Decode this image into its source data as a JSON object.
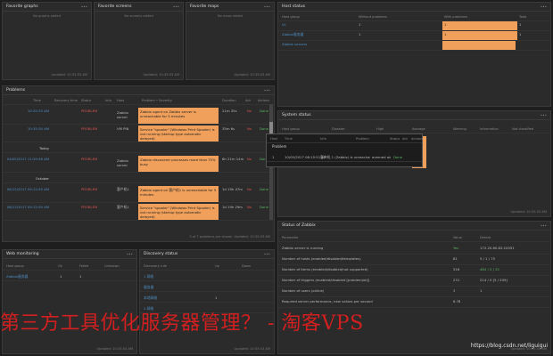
{
  "fav_graphs": {
    "title": "Favorite graphs",
    "empty": "No graphs added",
    "updated": "Updated: 10:35:03 AM"
  },
  "fav_screens": {
    "title": "Favorite screens",
    "empty": "No screens added",
    "updated": "Updated: 10:35:03 AM"
  },
  "fav_maps": {
    "title": "Favorite maps",
    "empty": "No maps added",
    "updated": "Updated: 10:35:03 AM"
  },
  "host_status": {
    "title": "Host status",
    "headers": [
      "Host group",
      "Without problems",
      "With problems",
      "Total"
    ],
    "rows": [
      {
        "group": "Vc",
        "without": "1",
        "with": "1",
        "total": "1"
      },
      {
        "group": "Zabbix服务器",
        "without": "1",
        "with": "1",
        "total": "1"
      },
      {
        "group": "Zabbix servers",
        "without": "",
        "with": "",
        "total": ""
      }
    ]
  },
  "problems": {
    "title": "Problems",
    "headers": [
      "Time",
      "Recovery time",
      "Status",
      "Info",
      "Host",
      "Problem • Severity",
      "Duration",
      "Ack",
      "Actions"
    ],
    "rows": [
      {
        "time": "10:35:33 AM",
        "status": "PROBLEM",
        "host": "Zabbix server",
        "problem": "Zabbix agent on Zabbix server is unreachable for 5 minutes",
        "duration": "21m 35s",
        "ack": "No",
        "action": "Done"
      },
      {
        "time": "10:35:30 AM",
        "status": "PROBLEM",
        "host": "VM PIN",
        "problem": "Service \"spooler\" (Windows Print Spooler) is not running (startup type automatic delayed)",
        "duration": "35m 6s",
        "ack": "No",
        "action": "Done"
      },
      {
        "time": "Today",
        "divider": true
      },
      {
        "time": "04/05/2017 11:59:46 AM",
        "status": "PROBLEM",
        "host": "Zabbix server",
        "problem": "Zabbix discoverer processes more than 75% busy",
        "duration": "6h 21m 14m",
        "ack": "No",
        "action": "Done"
      },
      {
        "time": "October",
        "divider": true
      },
      {
        "time": "06/12/2017 09:12:55 AM",
        "status": "PROBLEM",
        "host": "客户机1",
        "problem": "Zabbix agent on 客户机1 is unreachable for 5 minutes",
        "duration": "1d 19h 47m",
        "ack": "No",
        "action": "Done"
      },
      {
        "time": "06/12/2017 09:12:55 AM",
        "status": "PROBLEM",
        "host": "客户机1",
        "problem": "Service \"spooler\" (Windows Print Spooler) is not running (startup type automatic delayed)",
        "duration": "1d 19h 29m",
        "ack": "No",
        "action": "Done"
      }
    ],
    "footer": "5 of 7 problems are shown",
    "updated": "Updated: 10:35:03 AM"
  },
  "system_status": {
    "title": "System status",
    "headers": [
      "Host group",
      "Disaster",
      "High",
      "Average",
      "Warning",
      "Information",
      "Not classified"
    ],
    "popup": {
      "headers": [
        "Host",
        "Time",
        "Info",
        "Problem",
        "Status",
        "Ack",
        "Actions"
      ],
      "problem_label": "Problem",
      "row": {
        "host": "1",
        "time": "10/05/2017 08:15:51 AM",
        "info": "客户机 1 (Zabbix) is unreachable for...",
        "problem": "averned ok",
        "status": "Done"
      }
    },
    "updated": "Updated: 10:35:03 AM"
  },
  "web_monitoring": {
    "title": "Web monitoring",
    "headers": [
      "Host group",
      "Ok",
      "Failed",
      "Unknown"
    ],
    "rows": [
      {
        "group": "Zabbix服务器",
        "ok": "1",
        "failed": "1",
        "unknown": ""
      }
    ],
    "updated": "Updated: 10:35:03 AM"
  },
  "discovery_status": {
    "title": "Discovery status",
    "headers": [
      "Discovery rule",
      "Up",
      "Down"
    ],
    "rows": [
      {
        "rule": "1 网络",
        "up": "",
        "down": ""
      },
      {
        "rule": "服务器",
        "up": "",
        "down": ""
      },
      {
        "rule": "本地网络",
        "up": "1",
        "down": ""
      },
      {
        "rule": "2 网络",
        "up": "",
        "down": ""
      }
    ],
    "updated": "Updated: 10:35:03 AM"
  },
  "status_zabbix": {
    "title": "Status of Zabbix",
    "headers": [
      "Parameter",
      "Value",
      "Details"
    ],
    "rows": [
      {
        "param": "Zabbix server is running",
        "value": "Yes",
        "details": "172.20.60.82:10051"
      },
      {
        "param": "Number of hosts (enabled/disabled/templates)",
        "value": "81",
        "details": "5 / 1 / 75"
      },
      {
        "param": "Number of items (enabled/disabled/not supported)",
        "value": "516",
        "details": "484 / 0 / 32"
      },
      {
        "param": "Number of triggers (enabled/disabled [problem/ok])",
        "value": "231",
        "details": "214 / 0 [5 / 209]"
      },
      {
        "param": "Number of users (online)",
        "value": "3",
        "details": "1"
      },
      {
        "param": "Required server performance, new values per second",
        "value": "6.78",
        "details": ""
      }
    ],
    "updated": "Updated: 10:35:03 AM"
  },
  "watermark": "第三方工具优化服务器管理？ - 淘客VPS",
  "csdn": "https://blog.csdn.net/liguigui"
}
